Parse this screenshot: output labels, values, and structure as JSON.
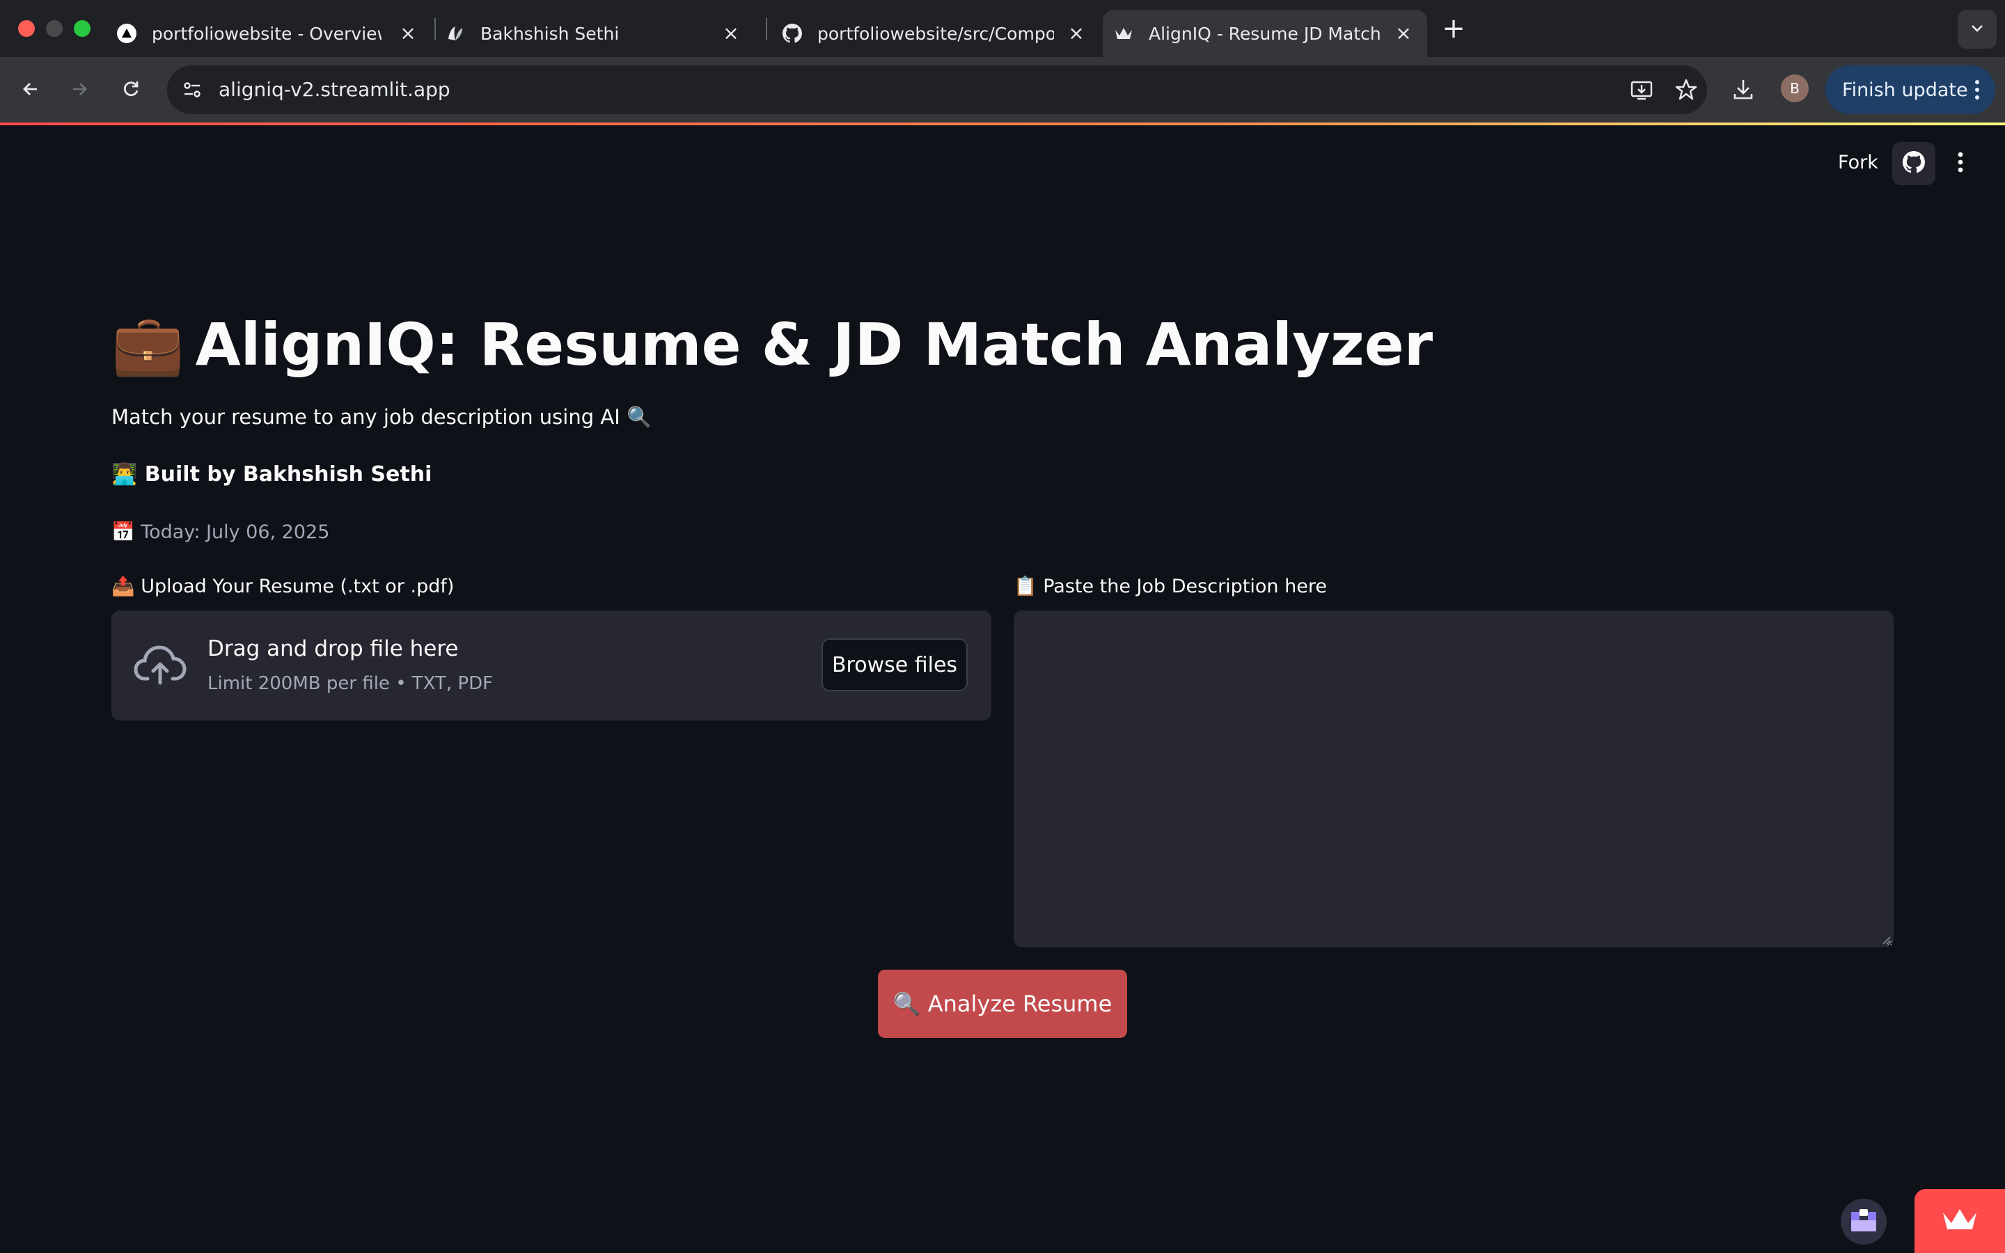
{
  "browser": {
    "tabs": [
      {
        "title": "portfoliowebsite - Overview –",
        "icon": "vercel-triangle-icon"
      },
      {
        "title": "Bakhshish Sethi",
        "icon": "site-logo-icon"
      },
      {
        "title": "portfoliowebsite/src/Compon",
        "icon": "github-icon"
      },
      {
        "title": "AlignIQ - Resume JD Matcher",
        "icon": "streamlit-crown-icon",
        "active": true
      }
    ],
    "new_tab_glyph": "+",
    "url": "aligniq-v2.streamlit.app",
    "profile_initial": "B",
    "finish_update_label": "Finish update"
  },
  "app_header": {
    "fork_label": "Fork"
  },
  "main": {
    "title_emoji": "💼",
    "title": "AlignIQ: Resume & JD Match Analyzer",
    "subtitle": "Match your resume to any job description using AI 🔍",
    "built_by": "👨‍💻 Built by Bakhshish Sethi",
    "today": "📅 Today: July 06, 2025"
  },
  "uploader": {
    "label": "📤 Upload Your Resume (.txt or .pdf)",
    "drag_text": "Drag and drop file here",
    "limit_text": "Limit 200MB per file • TXT, PDF",
    "browse_label": "Browse files"
  },
  "job_description": {
    "label": "📋 Paste the Job Description here",
    "value": ""
  },
  "analyze_button": {
    "label": "🔍 Analyze Resume"
  },
  "colors": {
    "background": "#0e1117",
    "widget_bg": "#262730",
    "primary_button": "#c24a4c",
    "streamlit_red": "#ff4b4b"
  }
}
